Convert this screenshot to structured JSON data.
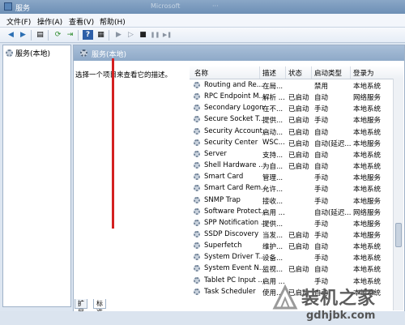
{
  "window": {
    "title": "服务",
    "title_blur": [
      "Microsoft",
      "···"
    ]
  },
  "menu": [
    {
      "label": "文件(F)"
    },
    {
      "label": "操作(A)"
    },
    {
      "label": "查看(V)"
    },
    {
      "label": "帮助(H)"
    }
  ],
  "toolbar": {
    "back": "◀",
    "forward": "▶",
    "console": "▤",
    "refresh": "⟳",
    "export": "⇥",
    "help": "?",
    "props": "▦",
    "start": "▶",
    "start2": "▷",
    "stop": "■",
    "pause": "❚❚",
    "restart": "▶❚"
  },
  "tree": {
    "item": "服务(本地)"
  },
  "panel": {
    "header": "服务(本地)",
    "description": "选择一个项目来查看它的描述。"
  },
  "columns": [
    "名称",
    "描述",
    "状态",
    "启动类型",
    "登录为"
  ],
  "rows": [
    [
      "Routing and Re...",
      "在局...",
      "",
      "禁用",
      "本地系统"
    ],
    [
      "RPC Endpoint M...",
      "解析 ...",
      "已启动",
      "自动",
      "网络服务"
    ],
    [
      "Secondary Logon",
      "在不...",
      "已启动",
      "手动",
      "本地系统"
    ],
    [
      "Secure Socket T...",
      "提供...",
      "已启动",
      "手动",
      "本地服务"
    ],
    [
      "Security Account...",
      "启动...",
      "已启动",
      "自动",
      "本地系统"
    ],
    [
      "Security Center",
      "WSC...",
      "已启动",
      "自动(延迟...",
      "本地服务"
    ],
    [
      "Server",
      "支持...",
      "已启动",
      "自动",
      "本地系统"
    ],
    [
      "Shell Hardware ...",
      "为自...",
      "已启动",
      "自动",
      "本地系统"
    ],
    [
      "Smart Card",
      "管理...",
      "",
      "手动",
      "本地服务"
    ],
    [
      "Smart Card Rem...",
      "允许...",
      "",
      "手动",
      "本地系统"
    ],
    [
      "SNMP Trap",
      "接收...",
      "",
      "手动",
      "本地服务"
    ],
    [
      "Software Protect...",
      "启用 ...",
      "",
      "自动(延迟...",
      "网络服务"
    ],
    [
      "SPP Notification ...",
      "提供...",
      "",
      "手动",
      "本地服务"
    ],
    [
      "SSDP Discovery",
      "当发...",
      "已启动",
      "手动",
      "本地服务"
    ],
    [
      "Superfetch",
      "维护...",
      "已启动",
      "自动",
      "本地系统"
    ],
    [
      "System Driver T...",
      "设备...",
      "",
      "手动",
      "本地系统"
    ],
    [
      "System Event N...",
      "监视...",
      "已启动",
      "自动",
      "本地系统"
    ],
    [
      "Tablet PC Input ...",
      "启用 ...",
      "",
      "手动",
      "本地系统"
    ],
    [
      "Task Scheduler",
      "使用...",
      "已启动",
      "自动",
      "本地系统"
    ]
  ],
  "tabs": [
    "扩展",
    "标准"
  ],
  "watermark": {
    "brand": "装机之家",
    "domain": "gdhjbk.com"
  },
  "colors": {
    "accent": "#d42020",
    "header": "#8ea9c8"
  }
}
